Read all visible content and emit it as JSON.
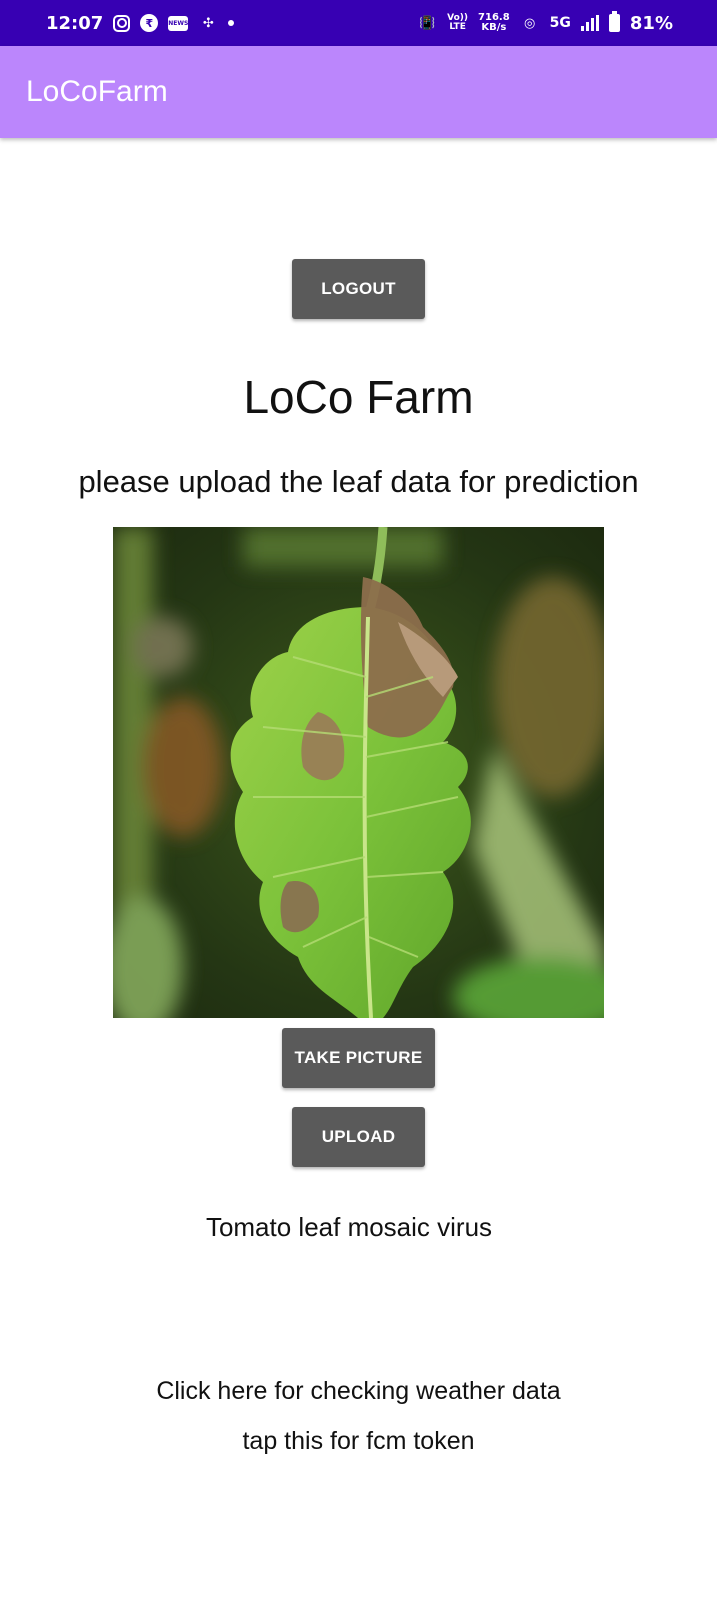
{
  "status_bar": {
    "time": "12:07",
    "nb_label": "NEWS",
    "network_top": "Vo))",
    "network_bottom": "LTE",
    "speed_value": "716.8",
    "speed_unit": "KB/s",
    "five_g": "5G",
    "battery_percent": "81%",
    "battery_level": 0.81
  },
  "app_bar": {
    "title": "LoCoFarm"
  },
  "main": {
    "logout_label": "LOGOUT",
    "title": "LoCo Farm",
    "subtitle": "please upload the leaf data for prediction",
    "take_picture_label": "TAKE PICTURE",
    "upload_label": "UPLOAD",
    "prediction_result": "Tomato leaf mosaic virus",
    "weather_link": "Click here for checking weather data",
    "fcm_link": "tap this for fcm token"
  },
  "colors": {
    "status_bar": "#3700b3",
    "app_bar": "#bb86fc",
    "button": "#5a5a5a"
  }
}
